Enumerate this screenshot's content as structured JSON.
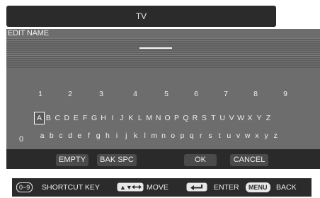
{
  "title": "TV",
  "panel": {
    "label": "EDIT NAME"
  },
  "keyboard": {
    "numbers": [
      "1",
      "2",
      "3",
      "4",
      "5",
      "6",
      "7",
      "8",
      "9"
    ],
    "zero": "0",
    "uppercase": [
      "A",
      "B",
      "C",
      "D",
      "E",
      "F",
      "G",
      "H",
      "I",
      "J",
      "K",
      "L",
      "M",
      "N",
      "O",
      "P",
      "Q",
      "R",
      "S",
      "T",
      "U",
      "V",
      "W",
      "X",
      "Y",
      "Z"
    ],
    "lowercase": [
      "a",
      "b",
      "c",
      "d",
      "e",
      "f",
      "g",
      "h",
      "i",
      "j",
      "k",
      "l",
      "m",
      "n",
      "o",
      "p",
      "q",
      "r",
      "s",
      "t",
      "u",
      "v",
      "w",
      "x",
      "y",
      "z"
    ],
    "symbols": [
      "1",
      "2",
      "3",
      "4",
      "5",
      "6",
      "7",
      "8",
      "9",
      "0",
      "",
      "_",
      "(",
      ")"
    ],
    "selected_key": "A"
  },
  "buttons": {
    "empty": "EMPTY",
    "backspace": "BAK SPC",
    "ok": "OK",
    "cancel": "CANCEL"
  },
  "help": {
    "shortcut_key": "0~9",
    "shortcut_label": "SHORTCUT KEY",
    "move_icon": "left-right-arrows-icon",
    "move_label": "MOVE",
    "enter_icon": "enter-return-icon",
    "enter_label": "ENTER",
    "menu_key": "MENU",
    "menu_label": "BACK"
  }
}
